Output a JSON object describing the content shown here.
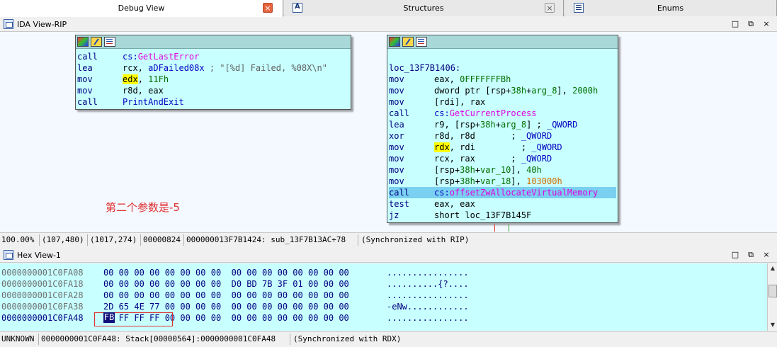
{
  "tabs": [
    {
      "label": "Debug View",
      "close": "×"
    },
    {
      "label": "Structures",
      "close": "×"
    },
    {
      "label": "Enums"
    }
  ],
  "ida_view": {
    "title": "IDA View-RIP",
    "win_buttons": [
      "□",
      "⧉",
      "×"
    ],
    "node_left": {
      "lines": [
        {
          "mn": "call",
          "op_parts": [
            {
              "t": "cs:",
              "c": "sym-blue"
            },
            {
              "t": "GetLastError",
              "c": "sym-pink"
            }
          ]
        },
        {
          "mn": "lea",
          "op_parts": [
            {
              "t": "rcx, ",
              "c": ""
            },
            {
              "t": "aDFailed08x",
              "c": "sym-blue"
            },
            {
              "t": " ; \"[%d] Failed, %08X\\n\"",
              "c": "cmt"
            }
          ]
        },
        {
          "mn": "mov",
          "op_parts": [
            {
              "t": "edx",
              "c": "hl"
            },
            {
              "t": ", ",
              "c": ""
            },
            {
              "t": "11Fh",
              "c": "sym-green"
            }
          ]
        },
        {
          "mn": "mov",
          "op_parts": [
            {
              "t": "r8d, eax",
              "c": ""
            }
          ]
        },
        {
          "mn": "call",
          "op_parts": [
            {
              "t": "PrintAndExit",
              "c": "sym-blue"
            }
          ]
        }
      ]
    },
    "node_right": {
      "label": "loc_13F7B1406:",
      "lines": [
        {
          "mn": "mov",
          "op_parts": [
            {
              "t": "eax, ",
              "c": ""
            },
            {
              "t": "0FFFFFFFBh",
              "c": "sym-green"
            }
          ]
        },
        {
          "mn": "mov",
          "op_parts": [
            {
              "t": "dword ptr [rsp+",
              "c": ""
            },
            {
              "t": "38h",
              "c": "sym-green"
            },
            {
              "t": "+",
              "c": ""
            },
            {
              "t": "arg_8",
              "c": "sym-green"
            },
            {
              "t": "], ",
              "c": ""
            },
            {
              "t": "2000h",
              "c": "sym-green"
            }
          ]
        },
        {
          "mn": "mov",
          "op_parts": [
            {
              "t": "[rdi], rax",
              "c": ""
            }
          ]
        },
        {
          "mn": "call",
          "op_parts": [
            {
              "t": "cs:",
              "c": "sym-blue"
            },
            {
              "t": "GetCurrentProcess",
              "c": "sym-pink"
            }
          ]
        },
        {
          "mn": "lea",
          "op_parts": [
            {
              "t": "r9, [rsp+",
              "c": ""
            },
            {
              "t": "38h",
              "c": "sym-green"
            },
            {
              "t": "+",
              "c": ""
            },
            {
              "t": "arg_8",
              "c": "sym-green"
            },
            {
              "t": "] ; ",
              "c": ""
            },
            {
              "t": "_QWORD",
              "c": "sym-blue"
            }
          ]
        },
        {
          "mn": "xor",
          "op_parts": [
            {
              "t": "r8d, r8d       ; ",
              "c": ""
            },
            {
              "t": "_QWORD",
              "c": "sym-blue"
            }
          ]
        },
        {
          "mn": "mov",
          "op_parts": [
            {
              "t": "rdx",
              "c": "hl"
            },
            {
              "t": ", rdi         ; ",
              "c": ""
            },
            {
              "t": "_QWORD",
              "c": "sym-blue"
            }
          ]
        },
        {
          "mn": "mov",
          "op_parts": [
            {
              "t": "rcx, rax       ; ",
              "c": ""
            },
            {
              "t": "_QWORD",
              "c": "sym-blue"
            }
          ]
        },
        {
          "mn": "mov",
          "op_parts": [
            {
              "t": "[rsp+",
              "c": ""
            },
            {
              "t": "38h",
              "c": "sym-green"
            },
            {
              "t": "+",
              "c": ""
            },
            {
              "t": "var_10",
              "c": "sym-green"
            },
            {
              "t": "], ",
              "c": ""
            },
            {
              "t": "40h",
              "c": "sym-green"
            }
          ]
        },
        {
          "mn": "mov",
          "op_parts": [
            {
              "t": "[rsp+",
              "c": ""
            },
            {
              "t": "38h",
              "c": "sym-green"
            },
            {
              "t": "+",
              "c": ""
            },
            {
              "t": "var_18",
              "c": "sym-green"
            },
            {
              "t": "], ",
              "c": ""
            },
            {
              "t": "103000h",
              "c": "sym-orange"
            }
          ]
        },
        {
          "mn": "call",
          "op_parts": [
            {
              "t": "cs:",
              "c": "sym-blue"
            },
            {
              "t": "offsetZwAllocateVirtualMemory",
              "c": "sym-pink"
            }
          ],
          "selected": true
        },
        {
          "mn": "test",
          "op_parts": [
            {
              "t": "eax, eax",
              "c": ""
            }
          ]
        },
        {
          "mn": "jz",
          "op_parts": [
            {
              "t": "short loc_13F7B145F",
              "c": ""
            }
          ]
        }
      ]
    },
    "annotation": "第二个参数是-5",
    "status": [
      "100.00%",
      "(107,480)",
      "(1017,274)",
      "00000824",
      "000000013F7B1424: sub_13F7B13AC+78",
      "(Synchronized with RIP)"
    ]
  },
  "hex_view": {
    "title": "Hex View-1",
    "win_buttons": [
      "□",
      "⧉",
      "×"
    ],
    "rows": [
      {
        "addr": "0000000001C0FA08",
        "bytes": "00 00 00 00 00 00 00 00  00 00 00 00 00 00 00 00",
        "ascii": "................"
      },
      {
        "addr": "0000000001C0FA18",
        "bytes": "00 00 00 00 00 00 00 00  D0 BD 7B 3F 01 00 00 00",
        "ascii": "..........{?...."
      },
      {
        "addr": "0000000001C0FA28",
        "bytes": "00 00 00 00 00 00 00 00  00 00 00 00 00 00 00 00",
        "ascii": "................"
      },
      {
        "addr": "0000000001C0FA38",
        "bytes": "2D 65 4E 77 00 00 00 00  00 00 00 00 00 00 00 00",
        "ascii": "-eNw............"
      },
      {
        "addr": "0000000001C0FA48",
        "bytes": "   FF FF FF 00 00 00 00  00 00 00 00 00 00 00 00",
        "ascii": "................"
      }
    ],
    "selected_byte": "FB",
    "status": [
      "UNKNOWN",
      "0000000001C0FA48: Stack[00000564]:0000000001C0FA48",
      "(Synchronized with RDX)"
    ]
  },
  "colors": {
    "node_bg": "#c8ffff",
    "selection": "#7ad0f0",
    "highlight": "#ffff00",
    "annotation": "#e03030"
  }
}
